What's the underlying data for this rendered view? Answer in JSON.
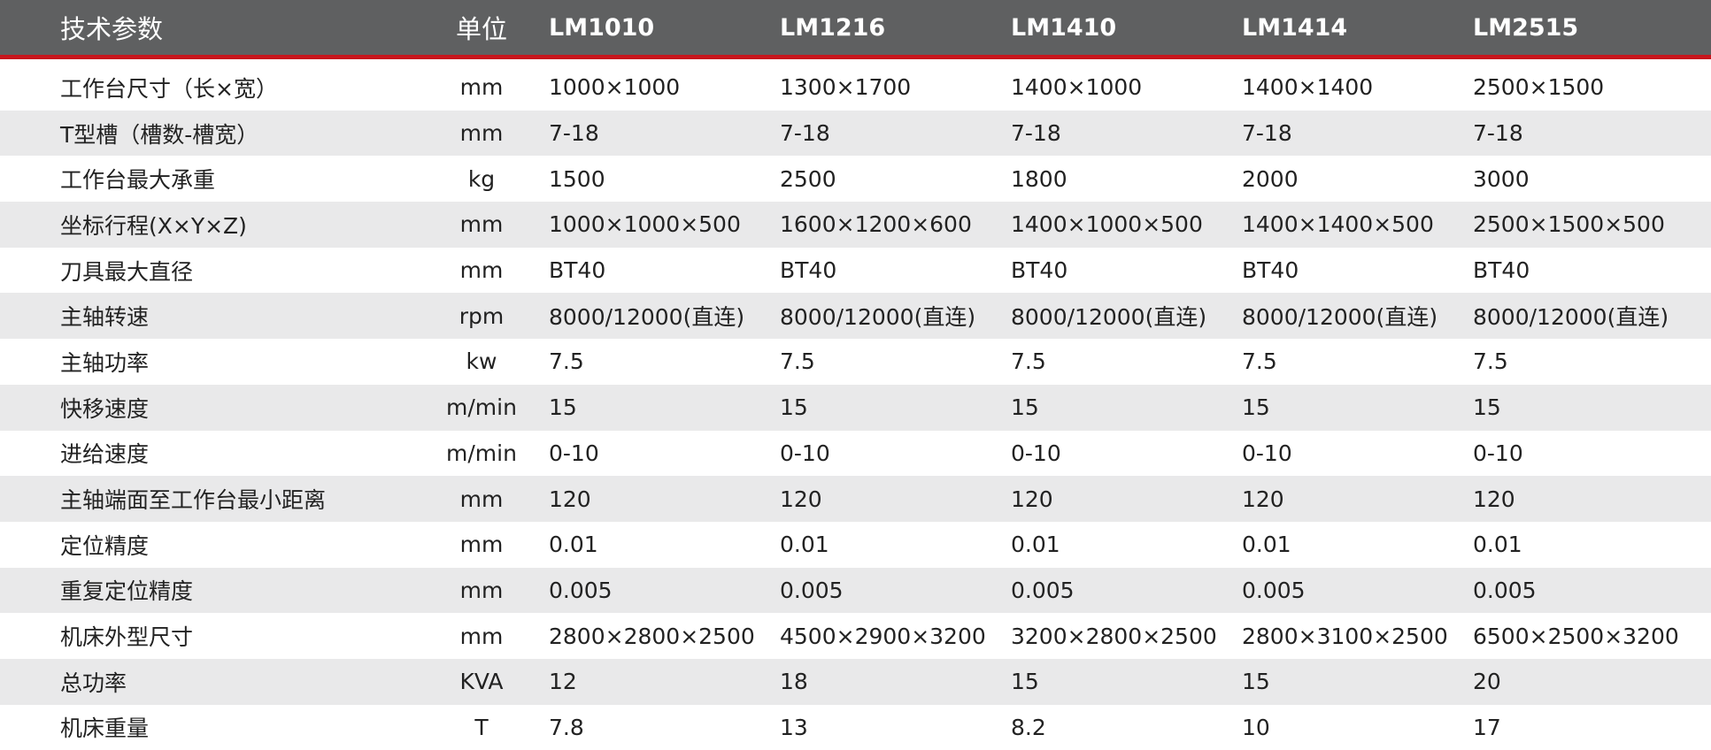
{
  "header": {
    "param": "技术参数",
    "unit": "单位",
    "models": [
      "LM1010",
      "LM1216",
      "LM1410",
      "LM1414",
      "LM2515"
    ]
  },
  "rows": [
    {
      "param": "工作台尺寸（长×宽）",
      "unit": "mm",
      "values": [
        "1000×1000",
        "1300×1700",
        "1400×1000",
        "1400×1400",
        "2500×1500"
      ]
    },
    {
      "param": "T型槽（槽数-槽宽）",
      "unit": "mm",
      "values": [
        "7-18",
        "7-18",
        "7-18",
        "7-18",
        "7-18"
      ]
    },
    {
      "param": "工作台最大承重",
      "unit": "kg",
      "values": [
        "1500",
        "2500",
        "1800",
        "2000",
        "3000"
      ]
    },
    {
      "param": "坐标行程(X×Y×Z)",
      "unit": "mm",
      "values": [
        "1000×1000×500",
        "1600×1200×600",
        "1400×1000×500",
        "1400×1400×500",
        "2500×1500×500"
      ]
    },
    {
      "param": "刀具最大直径",
      "unit": "mm",
      "values": [
        "BT40",
        "BT40",
        "BT40",
        "BT40",
        "BT40"
      ]
    },
    {
      "param": "主轴转速",
      "unit": "rpm",
      "values": [
        "8000/12000(直连)",
        "8000/12000(直连)",
        "8000/12000(直连)",
        "8000/12000(直连)",
        "8000/12000(直连)"
      ]
    },
    {
      "param": "主轴功率",
      "unit": "kw",
      "values": [
        "7.5",
        "7.5",
        "7.5",
        "7.5",
        "7.5"
      ]
    },
    {
      "param": "快移速度",
      "unit": "m/min",
      "values": [
        "15",
        "15",
        "15",
        "15",
        "15"
      ]
    },
    {
      "param": "进给速度",
      "unit": "m/min",
      "values": [
        "0-10",
        "0-10",
        "0-10",
        "0-10",
        "0-10"
      ]
    },
    {
      "param": "主轴端面至工作台最小距离",
      "unit": "mm",
      "values": [
        "120",
        "120",
        "120",
        "120",
        "120"
      ]
    },
    {
      "param": "定位精度",
      "unit": "mm",
      "values": [
        "0.01",
        "0.01",
        "0.01",
        "0.01",
        "0.01"
      ]
    },
    {
      "param": "重复定位精度",
      "unit": "mm",
      "values": [
        "0.005",
        "0.005",
        "0.005",
        "0.005",
        "0.005"
      ]
    },
    {
      "param": "机床外型尺寸",
      "unit": "mm",
      "values": [
        "2800×2800×2500",
        "4500×2900×3200",
        "3200×2800×2500",
        "2800×3100×2500",
        "6500×2500×3200"
      ]
    },
    {
      "param": "总功率",
      "unit": "KVA",
      "values": [
        "12",
        "18",
        "15",
        "15",
        "20"
      ]
    },
    {
      "param": "机床重量",
      "unit": "T",
      "values": [
        "7.8",
        "13",
        "8.2",
        "10",
        "17"
      ]
    }
  ],
  "colors": {
    "header_bg": "#5f6061",
    "header_accent": "#c8161d",
    "row_alt_bg": "#e9e9ea",
    "text": "#222222"
  }
}
